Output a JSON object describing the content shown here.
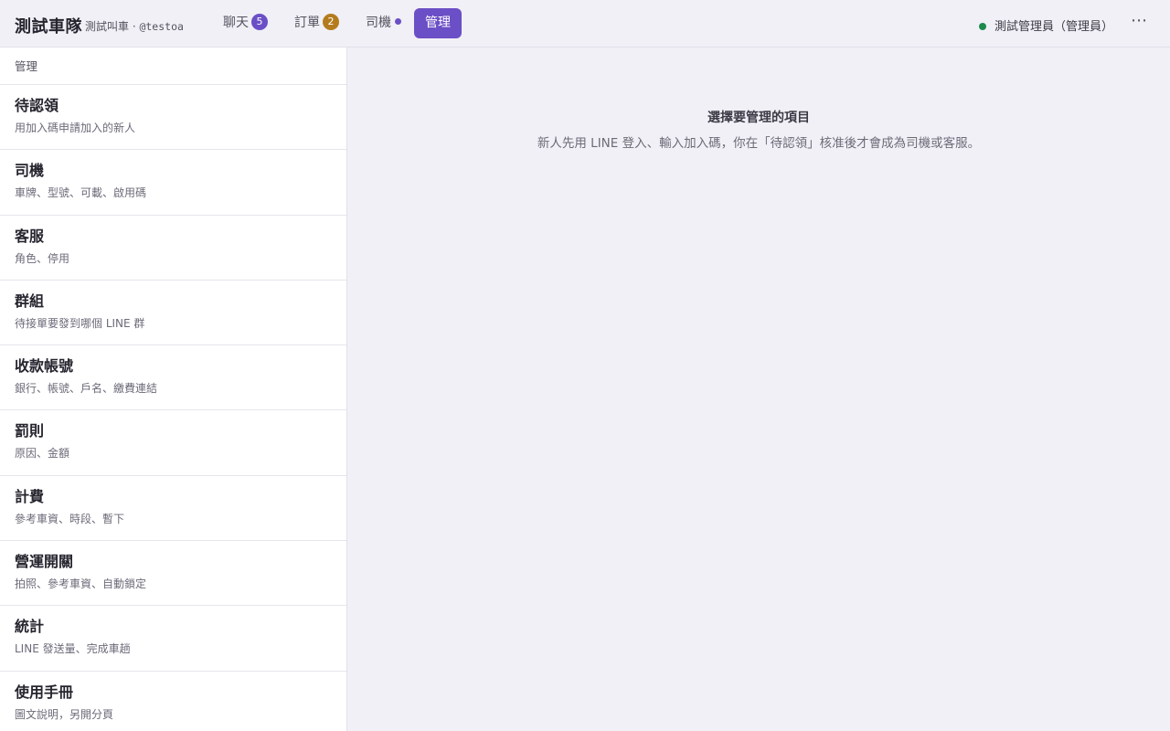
{
  "header": {
    "brand": "測試車隊",
    "subtitle": "測試叫車 · ",
    "handle": "@testoa",
    "tabs": {
      "chat": {
        "label": "聊天",
        "badge": "5"
      },
      "orders": {
        "label": "訂單",
        "badge": "2"
      },
      "drivers": {
        "label": "司機"
      },
      "admin": {
        "label": "管理"
      }
    },
    "user": "測試管理員（管理員）",
    "more": "⋯"
  },
  "sidebar": {
    "header": "管理",
    "items": [
      {
        "title": "待認領",
        "desc": "用加入碼申請加入的新人"
      },
      {
        "title": "司機",
        "desc": "車牌、型號、可載、啟用碼"
      },
      {
        "title": "客服",
        "desc": "角色、停用"
      },
      {
        "title": "群組",
        "desc": "待接單要發到哪個 LINE 群"
      },
      {
        "title": "收款帳號",
        "desc": "銀行、帳號、戶名、繳費連結"
      },
      {
        "title": "罰則",
        "desc": "原因、金額"
      },
      {
        "title": "計費",
        "desc": "參考車資、時段、暫下"
      },
      {
        "title": "營運開關",
        "desc": "拍照、參考車資、自動鎖定"
      },
      {
        "title": "統計",
        "desc": "LINE 發送量、完成車趟"
      },
      {
        "title": "使用手冊",
        "desc": "圖文說明，另開分頁"
      }
    ]
  },
  "main": {
    "empty_title": "選擇要管理的項目",
    "empty_desc": "新人先用 LINE 登入、輸入加入碼，你在「待認領」核准後才會成為司機或客服。"
  },
  "colors": {
    "accent": "#6b4fc6",
    "orders_badge": "#b47b1e",
    "online": "#1e8a4c"
  },
  "icons": {
    "online_status": "online-dot-icon",
    "drivers_indicator": "dot-indicator-icon",
    "more": "more-options-icon"
  }
}
